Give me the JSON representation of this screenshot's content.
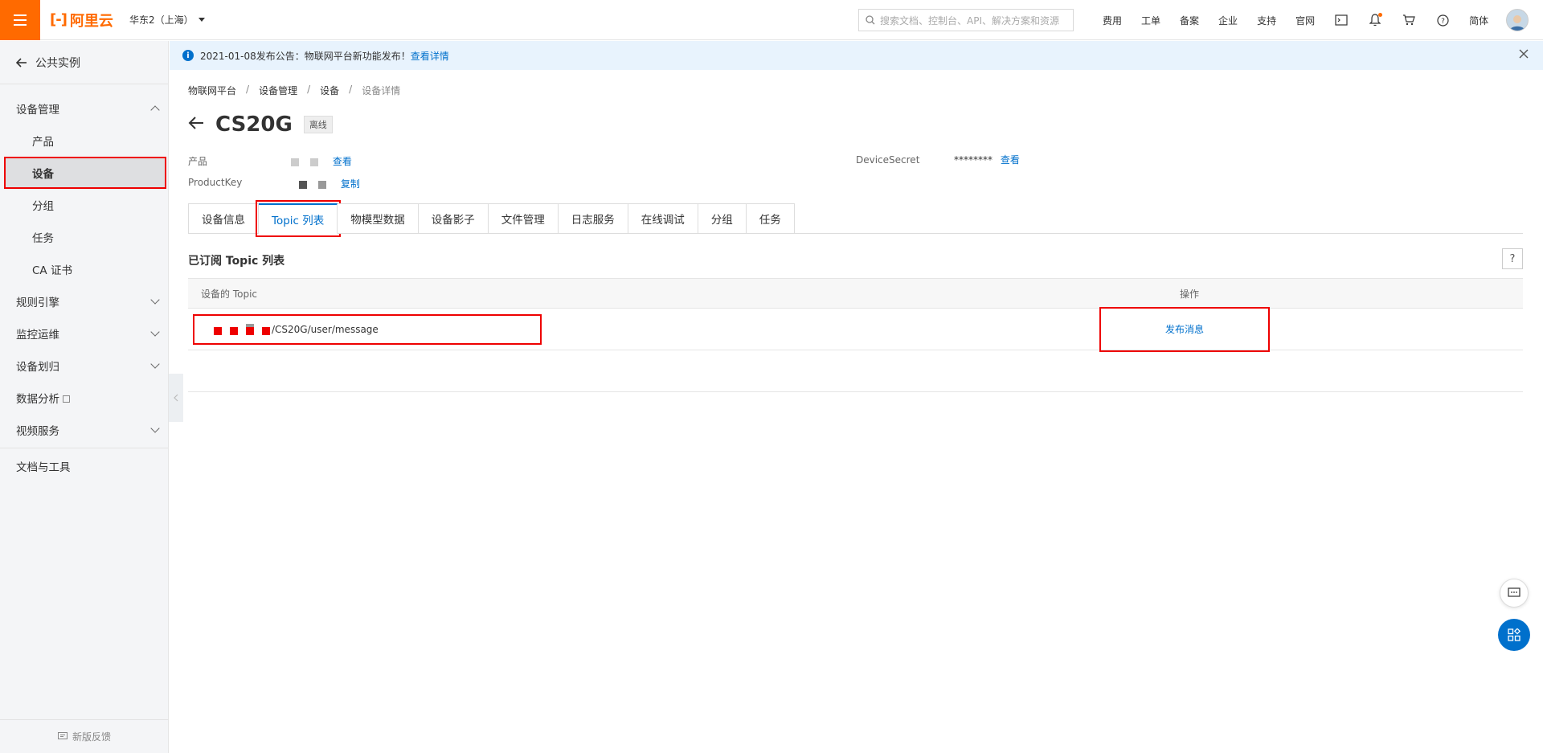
{
  "topbar": {
    "logo_text": "阿里云",
    "region": "华东2（上海）",
    "search_placeholder": "搜索文档、控制台、API、解决方案和资源",
    "nav": [
      "费用",
      "工单",
      "备案",
      "企业",
      "支持",
      "官网"
    ],
    "lang": "简体",
    "accent": "#ff6a00"
  },
  "sidebar": {
    "back_label": "公共实例",
    "groups": [
      {
        "label": "设备管理",
        "expanded": true
      },
      {
        "label": "规则引擎"
      },
      {
        "label": "监控运维"
      },
      {
        "label": "设备划归"
      },
      {
        "label": "数据分析"
      },
      {
        "label": "视频服务"
      }
    ],
    "sub_items": [
      "产品",
      "设备",
      "分组",
      "任务",
      "CA 证书"
    ],
    "docs_label": "文档与工具",
    "feedback_label": "新版反馈"
  },
  "notice": {
    "text": "2021-01-08发布公告：物联网平台新功能发布！",
    "link": "查看详情"
  },
  "breadcrumb": [
    "物联网平台",
    "设备管理",
    "设备",
    "设备详情"
  ],
  "device": {
    "name": "CS20G",
    "status": "离线",
    "product_label": "产品",
    "product_link": "查看",
    "productkey_label": "ProductKey",
    "productkey_link": "复制",
    "secret_label": "DeviceSecret",
    "secret_value": "********",
    "secret_link": "查看"
  },
  "tabs": [
    "设备信息",
    "Topic 列表",
    "物模型数据",
    "设备影子",
    "文件管理",
    "日志服务",
    "在线调试",
    "分组",
    "任务"
  ],
  "active_tab": "Topic 列表",
  "section": {
    "title": "已订阅 Topic 列表",
    "help": "?"
  },
  "table": {
    "columns": [
      "设备的 Topic",
      "操作"
    ],
    "rows": [
      {
        "topic": "/CS20G/user/message",
        "action": "发布消息"
      }
    ]
  },
  "colors": {
    "link": "#0070cc",
    "highlight": "#ee0000"
  }
}
